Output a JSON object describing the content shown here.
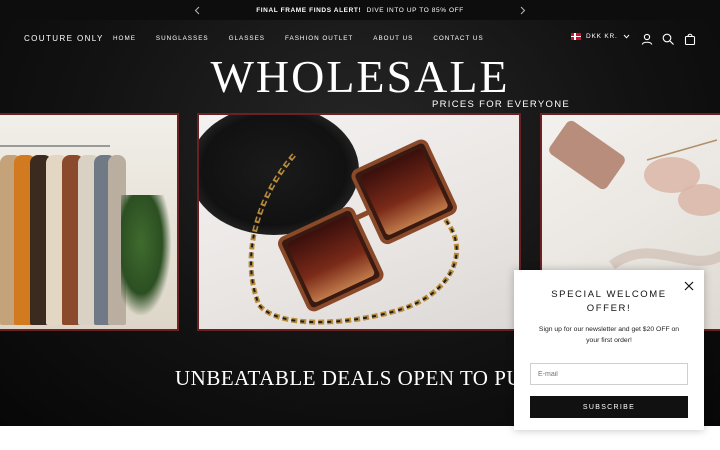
{
  "announcement": {
    "bold": "FINAL FRAME FINDS ALERT!",
    "text": "DIVE INTO UP TO 85% OFF"
  },
  "header": {
    "logo": "COUTURE ONLY",
    "nav": [
      "HOME",
      "SUNGLASSES",
      "GLASSES",
      "FASHION OUTLET",
      "ABOUT US",
      "CONTACT US"
    ],
    "currency": "DKK KR."
  },
  "hero": {
    "headline": "WHOLESALE",
    "subline": "PRICES FOR EVERYONE",
    "deals": "UNBEATABLE DEALS OPEN TO PUBL"
  },
  "popup": {
    "title": "SPECIAL WELCOME OFFER!",
    "text": "Sign up for our newsletter and get $20 OFF on your first order!",
    "email_placeholder": "E-mail",
    "button": "SUBSCRIBE"
  },
  "icons": {
    "prev": "chevron-left-icon",
    "next": "chevron-right-icon",
    "account": "user-icon",
    "search": "search-icon",
    "cart": "shopping-bag-icon",
    "close": "close-icon"
  },
  "colors": {
    "announcement_bg": "#0d0d0d",
    "panel_border": "#6b2121",
    "button_bg": "#111111"
  }
}
